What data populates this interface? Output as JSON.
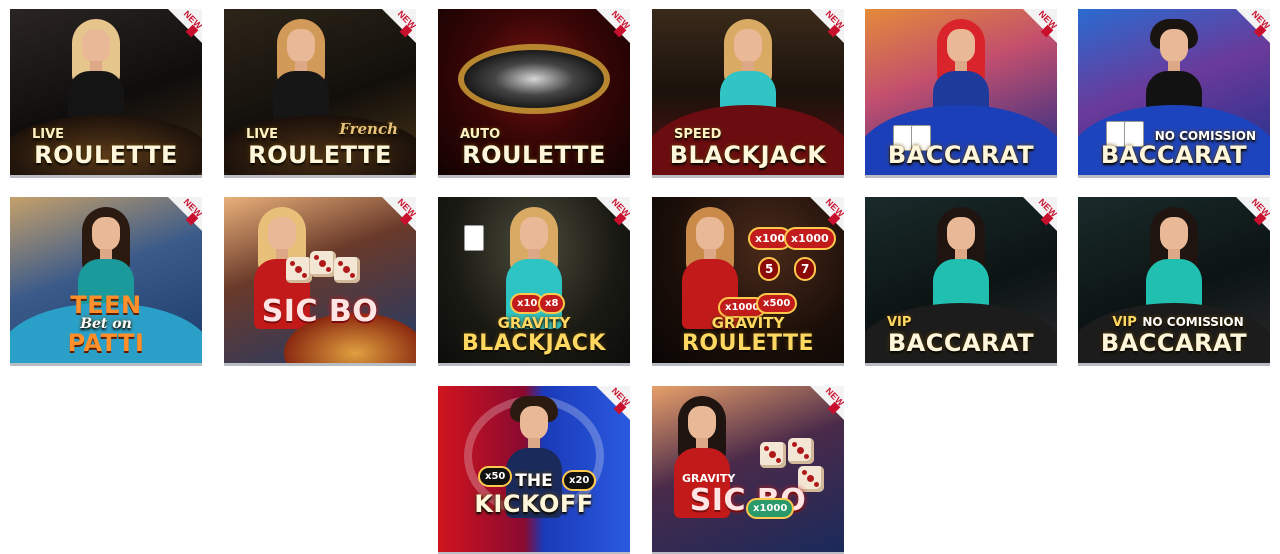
{
  "badge_text": "NEW",
  "tiles": [
    {
      "name": "live-roulette",
      "top": "LIVE",
      "main": "ROULETTE",
      "extra": ""
    },
    {
      "name": "live-roulette-french",
      "top": "LIVE",
      "main": "ROULETTE",
      "extra": "French"
    },
    {
      "name": "auto-roulette",
      "top": "AUTO",
      "main": "ROULETTE",
      "extra": ""
    },
    {
      "name": "speed-blackjack",
      "top": "SPEED",
      "main": "BLACKJACK",
      "extra": ""
    },
    {
      "name": "baccarat",
      "top": "",
      "main": "BACCARAT",
      "extra": ""
    },
    {
      "name": "baccarat-no-commission",
      "top": "NO COMISSION",
      "main": "BACCARAT",
      "extra": ""
    },
    {
      "name": "teen-patti",
      "top": "TEEN",
      "main": "PATTI",
      "extra": "Bet on"
    },
    {
      "name": "sic-bo",
      "top": "",
      "main": "SIC BO",
      "extra": ""
    },
    {
      "name": "gravity-blackjack",
      "top": "GRAVITY",
      "main": "BLACKJACK",
      "extra": ""
    },
    {
      "name": "gravity-roulette",
      "top": "GRAVITY",
      "main": "ROULETTE",
      "extra": ""
    },
    {
      "name": "vip-baccarat",
      "top": "VIP",
      "main": "BACCARAT",
      "extra": ""
    },
    {
      "name": "vip-baccarat-no-commission",
      "top": "VIP",
      "main": "BACCARAT",
      "extra": "NO COMISSION"
    },
    {
      "name": "the-kickoff",
      "top": "THE",
      "main": "KICKOFF",
      "extra": ""
    },
    {
      "name": "gravity-sic-bo",
      "top": "GRAVITY",
      "main": "SIC BO",
      "extra": "x1000"
    }
  ],
  "multipliers": {
    "gravity_roulette": [
      "x100",
      "x1000",
      "5",
      "7",
      "x1000",
      "x500"
    ],
    "gravity_blackjack": [
      "x10",
      "x8"
    ],
    "kickoff": [
      "x50",
      "x20"
    ]
  }
}
